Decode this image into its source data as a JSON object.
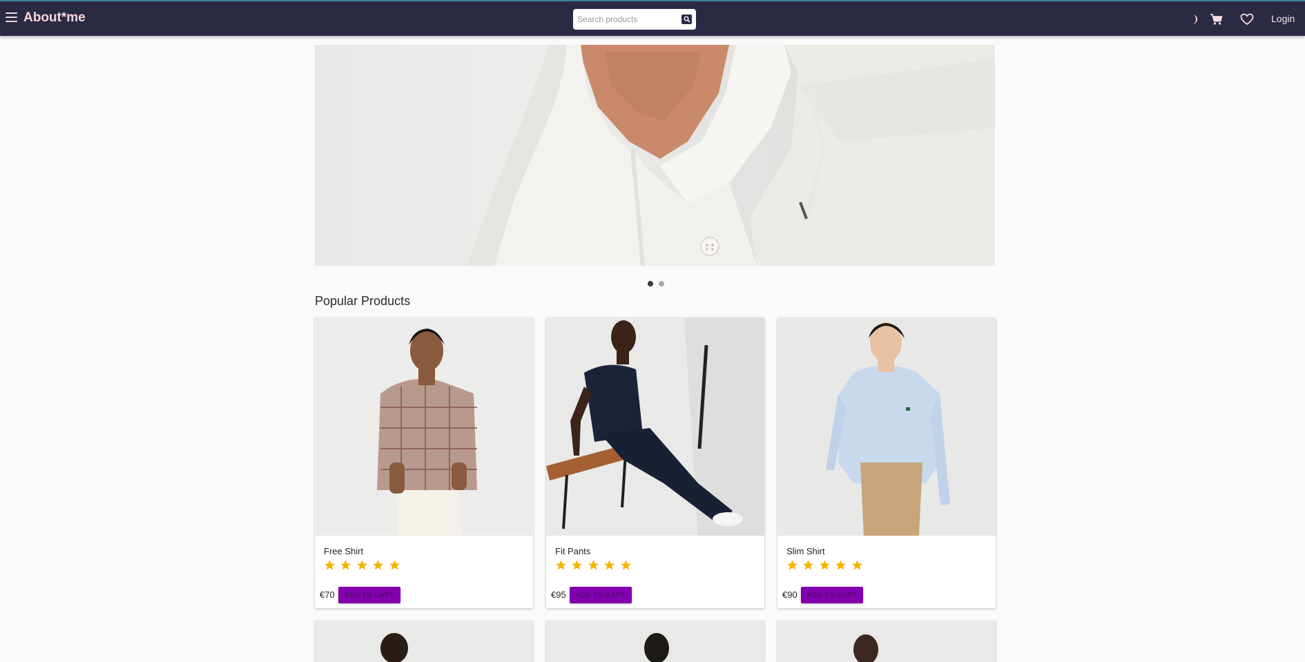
{
  "header": {
    "brand": "About*me",
    "search_placeholder": "Search products",
    "login_label": "Login",
    "icons": [
      "menu-icon",
      "search-icon",
      "dark-mode-icon",
      "cart-icon",
      "heart-icon"
    ]
  },
  "hero": {
    "slides": 2,
    "active_slide": 1
  },
  "section": {
    "title": "Popular Products"
  },
  "products": [
    {
      "name": "Free Shirt",
      "rating": 5,
      "price": "€70",
      "button": "ADD TO CART"
    },
    {
      "name": "Fit Pants",
      "rating": 5,
      "price": "€95",
      "button": "ADD TO CART"
    },
    {
      "name": "Slim Shirt",
      "rating": 5,
      "price": "€90",
      "button": "ADD TO CART"
    }
  ],
  "colors": {
    "header_bg": "#2b2a45",
    "brand": "#f6d5d8",
    "button_bg": "#8300b0",
    "star": "#f5b400"
  }
}
